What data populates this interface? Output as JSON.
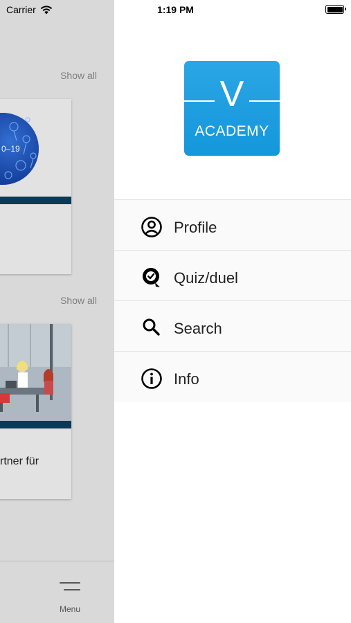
{
  "status_bar": {
    "carrier": "Carrier",
    "time": "1:19 PM"
  },
  "background": {
    "section1_show_all": "Show all",
    "section2_show_all": "Show all",
    "card1_image_text": "0–19",
    "card2_title": "rtner für",
    "tabbar_menu_label": "Menu"
  },
  "logo": {
    "letter": "V",
    "wordmark": "ACADEMY",
    "color": "#1e9fe0"
  },
  "menu": {
    "items": [
      {
        "label": "Profile",
        "icon": "profile-icon"
      },
      {
        "label": "Quiz/duel",
        "icon": "quiz-icon"
      },
      {
        "label": "Search",
        "icon": "search-icon"
      },
      {
        "label": "Info",
        "icon": "info-icon"
      }
    ]
  }
}
